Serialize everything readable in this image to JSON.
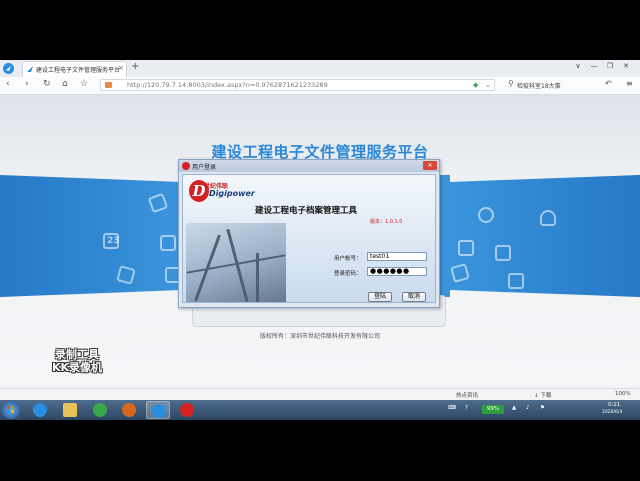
{
  "browser": {
    "tab_title": "建设工程电子文件管理服务平台",
    "tab_close": "×",
    "new_tab": "+",
    "url": "http://120.79.7.14:8003/index.aspx?n=0.9762871621233289",
    "search_text": "检疫科室18大事",
    "window_buttons": [
      "∨",
      "—",
      "❐",
      "✕"
    ]
  },
  "page": {
    "title": "建设工程电子文件管理服务平台",
    "calendar_day": "23",
    "copyright": "版权所有：深圳市世纪伟联科技开发有限公司"
  },
  "dialog": {
    "title": "用户登录",
    "close": "✕",
    "brand_cn": "世纪伟联",
    "brand_en": "Digipower",
    "tool_title": "建设工程电子档案管理工具",
    "version": "版本：1.0.1.0",
    "username_label": "用户帐号：",
    "username_value": "test01",
    "password_label": "登录密码：",
    "password_value": "●●●●●●",
    "login_button": "登陆",
    "cancel_button": "取消"
  },
  "watermark": {
    "line1": "录制工具",
    "line2": "KK录像机"
  },
  "statusbar": {
    "items": [
      "热点资讯",
      "↓ 下载",
      "100%"
    ]
  },
  "taskbar": {
    "battery": "99%",
    "time": "0:21",
    "date": "2020/6/4"
  },
  "colors": {
    "accent_blue": "#2a86d6",
    "band_blue": "#2578c6",
    "brand_red": "#d42121"
  }
}
